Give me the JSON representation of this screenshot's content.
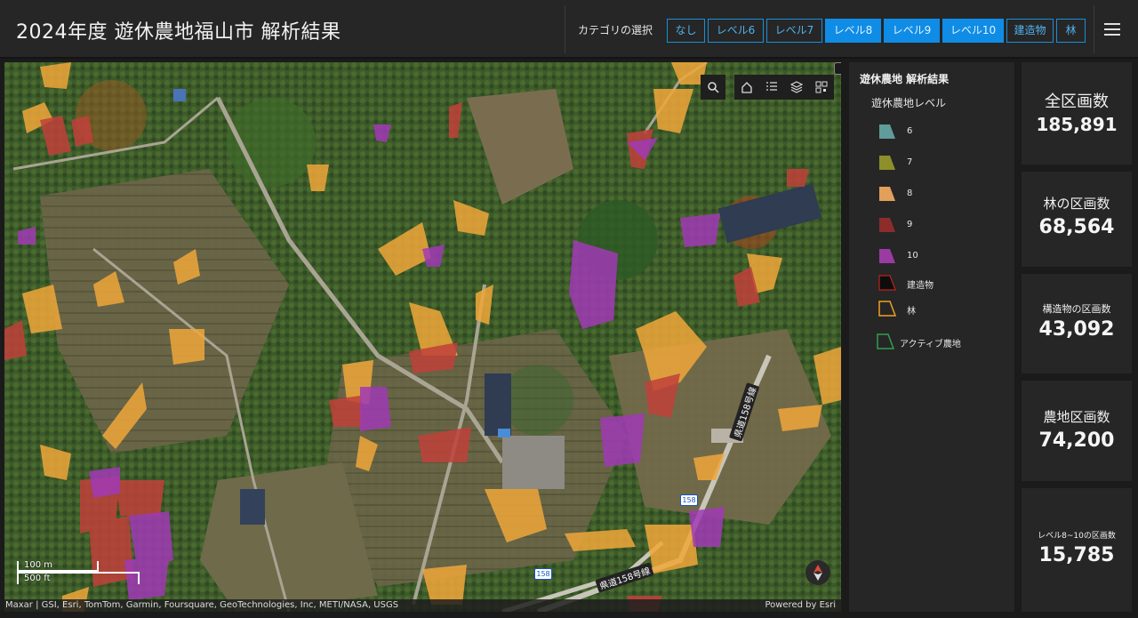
{
  "header": {
    "title": "2024年度 遊休農地福山市 解析結果",
    "category_label": "カテゴリの選択",
    "categories": [
      {
        "label": "なし",
        "active": false
      },
      {
        "label": "レベル6",
        "active": false
      },
      {
        "label": "レベル7",
        "active": false
      },
      {
        "label": "レベル8",
        "active": true
      },
      {
        "label": "レベル9",
        "active": true
      },
      {
        "label": "レベル10",
        "active": true
      },
      {
        "label": "建造物",
        "active": false
      },
      {
        "label": "林",
        "active": false
      }
    ],
    "menu_icon": "hamburger-icon"
  },
  "map": {
    "tools": [
      "search-icon",
      "home-icon",
      "list-icon",
      "layers-icon",
      "qrcode-icon"
    ],
    "scale_metric": "100 m",
    "scale_imperial": "500 ft",
    "attribution": "Maxar | GSI, Esri, TomTom, Garmin, Foursquare, GeoTechnologies, Inc, METI/NASA, USGS",
    "powered_by": "Powered by Esri",
    "road_label_1": "県道158号線",
    "road_label_2": "県道158号線",
    "route_badge_1": "158",
    "route_badge_2": "158"
  },
  "legend": {
    "title": "遊休農地 解析結果",
    "subtitle": "遊休農地レベル",
    "items": [
      {
        "label": "6",
        "color": "#5f9c9b",
        "style": "fill"
      },
      {
        "label": "7",
        "color": "#8d8f2b",
        "style": "fill"
      },
      {
        "label": "8",
        "color": "#e2a05a",
        "style": "fill"
      },
      {
        "label": "9",
        "color": "#8e2b2b",
        "style": "fill"
      },
      {
        "label": "10",
        "color": "#9a3aa2",
        "style": "fill"
      },
      {
        "label": "建造物",
        "color": "#000000",
        "style": "outline-red"
      },
      {
        "label": "林",
        "color": "#f0a020",
        "style": "outline"
      },
      {
        "label": "アクティブ農地",
        "color": "#2e9f4a",
        "style": "outline"
      }
    ]
  },
  "stats": [
    {
      "label": "全区画数",
      "value": "185,891"
    },
    {
      "label": "林の区画数",
      "value": "68,564"
    },
    {
      "label": "構造物の区画数",
      "value": "43,092"
    },
    {
      "label": "農地区画数",
      "value": "74,200"
    },
    {
      "label": "レベル8~10の区画数",
      "value": "15,785"
    }
  ],
  "colors": {
    "accent": "#0f8ce6",
    "level8": "#f0a73a",
    "level9": "#c0413a",
    "level10": "#a03ab5"
  }
}
